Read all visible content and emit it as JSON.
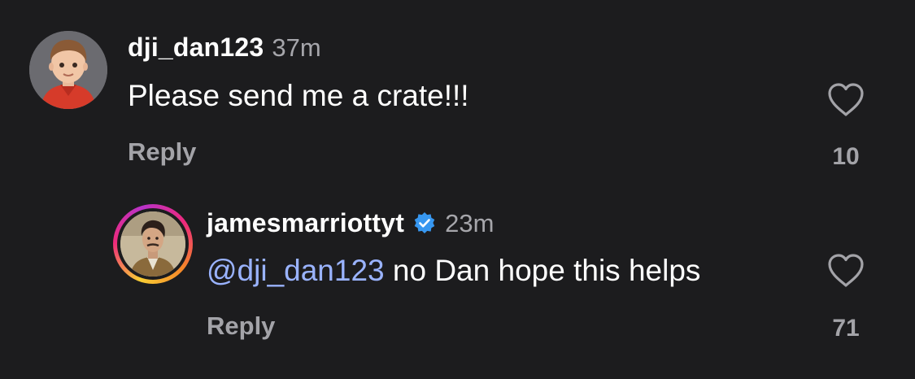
{
  "comments": [
    {
      "username": "dji_dan123",
      "timestamp": "37m",
      "verified": false,
      "text": "Please send me a crate!!!",
      "reply_label": "Reply",
      "like_count": "10"
    },
    {
      "username": "jamesmarriottyt",
      "timestamp": "23m",
      "verified": true,
      "mention": "@dji_dan123",
      "text": " no Dan hope this helps",
      "reply_label": "Reply",
      "like_count": "71"
    }
  ],
  "icons": {
    "like": "heart-outline-icon",
    "verified": "verified-badge-icon"
  },
  "colors": {
    "background": "#1c1c1e",
    "mention": "#9ab3ff",
    "verified": "#3797f0",
    "muted": "#a3a3a8"
  }
}
